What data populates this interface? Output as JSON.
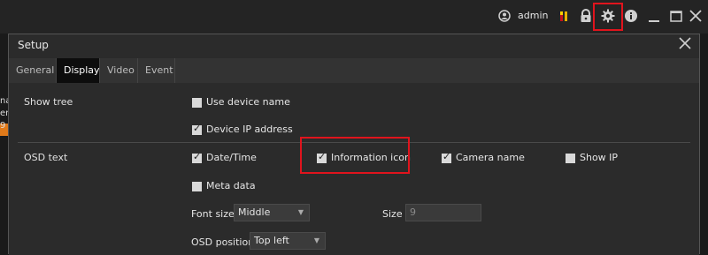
{
  "topbar": {
    "user_icon": "user-circle-icon",
    "user_name": "admin",
    "icons": [
      "alarm-icon",
      "lock-icon",
      "gear-icon",
      "info-icon",
      "minimize-icon",
      "maximize-icon",
      "close-icon"
    ]
  },
  "background": {
    "left_fragment": "na\ner\n9"
  },
  "dialog": {
    "title": "Setup",
    "close_icon": "close-icon",
    "tabs": [
      {
        "label": "General",
        "active": false
      },
      {
        "label": "Display",
        "active": true
      },
      {
        "label": "Video",
        "active": false
      },
      {
        "label": "Event",
        "active": false
      }
    ],
    "show_tree": {
      "label": "Show tree",
      "options": [
        {
          "label": "Use device name",
          "checked": false
        },
        {
          "label": "Device IP address",
          "checked": true
        }
      ]
    },
    "osd_text": {
      "label": "OSD text",
      "options": [
        {
          "label": "Date/Time",
          "checked": true
        },
        {
          "label": "Information icon",
          "checked": true
        },
        {
          "label": "Camera name",
          "checked": true
        },
        {
          "label": "Show IP",
          "checked": false
        },
        {
          "label": "Meta data",
          "checked": false
        }
      ],
      "font_size": {
        "label": "Font size",
        "value": "Middle"
      },
      "size": {
        "label": "Size",
        "value": "9"
      },
      "osd_position": {
        "label": "OSD position",
        "value": "Top left"
      }
    }
  },
  "colors": {
    "highlight": "#e0141d",
    "accent_orange": "#e07a1a",
    "background": "#1a1a1a",
    "dialog": "#2b2b2b"
  }
}
